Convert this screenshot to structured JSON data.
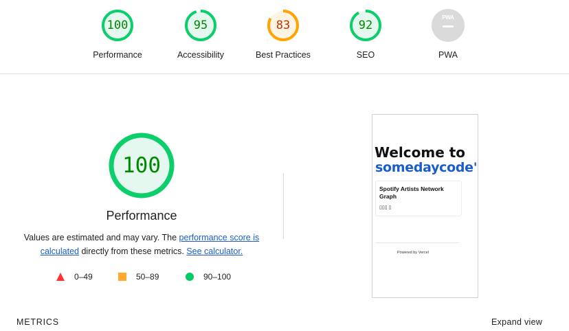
{
  "summary": {
    "gauges": [
      {
        "score": "100",
        "label": "Performance",
        "status": "pass",
        "fraction": 1.0
      },
      {
        "score": "95",
        "label": "Accessibility",
        "status": "pass",
        "fraction": 0.95
      },
      {
        "score": "83",
        "label": "Best Practices",
        "status": "average",
        "fraction": 0.83
      },
      {
        "score": "92",
        "label": "SEO",
        "status": "pass",
        "fraction": 0.92
      }
    ],
    "pwa": {
      "badge_text": "PWA",
      "label": "PWA"
    }
  },
  "performance": {
    "score": "100",
    "fraction": 1.0,
    "title": "Performance",
    "desc_prefix": "Values are estimated and may vary. The ",
    "desc_link1": "performance score is calculated",
    "desc_middle": " directly from these metrics. ",
    "desc_link2": "See calculator."
  },
  "legend": {
    "fail": "0–49",
    "average": "50–89",
    "pass": "90–100"
  },
  "screenshot": {
    "welcome": "Welcome to",
    "site": "somedaycode's",
    "card_title": "Spotify Artists Network Graph",
    "card_tag": "▯▯▯ ▯",
    "powered": "Powered by ",
    "powered_brand": "Vercel"
  },
  "footer": {
    "metrics": "METRICS",
    "expand": "Expand view"
  },
  "colors": {
    "pass": "#0cce6b",
    "pass_text": "#008800",
    "average": "#ffa400",
    "average_text": "#c33300",
    "fail": "#ff3333",
    "pwa_grey": "#dadada",
    "link": "#1a5ccc"
  }
}
